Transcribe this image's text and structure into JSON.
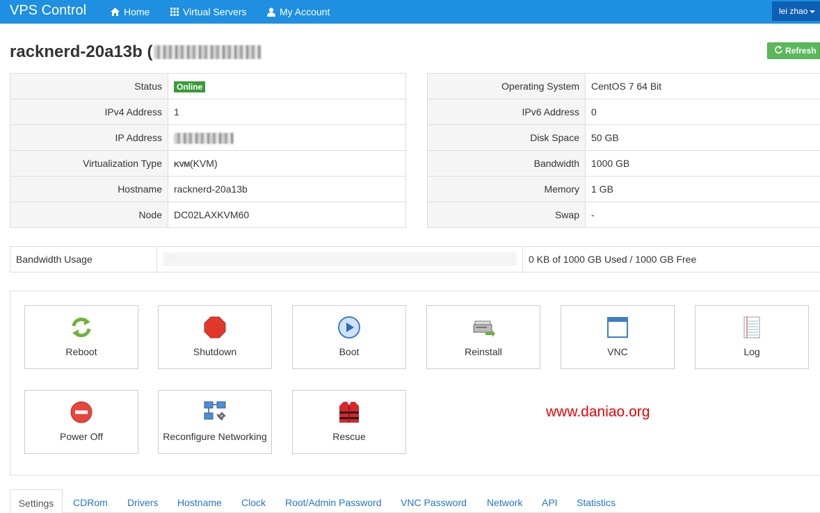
{
  "nav": {
    "brand": "VPS Control",
    "items": [
      {
        "label": "Home",
        "icon": "home-icon"
      },
      {
        "label": "Virtual Servers",
        "icon": "grid-icon"
      },
      {
        "label": "My Account",
        "icon": "user-icon"
      }
    ],
    "user": "lei zhao"
  },
  "page": {
    "title": "racknerd-20a13b (",
    "refresh_label": "Refresh"
  },
  "left_table": [
    {
      "label": "Status",
      "value": "Online"
    },
    {
      "label": "IPv4 Address",
      "value": "1"
    },
    {
      "label": "IP Address",
      "value": ""
    },
    {
      "label": "Virtualization Type",
      "value": "(KVM)",
      "logo": "KVM"
    },
    {
      "label": "Hostname",
      "value": "racknerd-20a13b"
    },
    {
      "label": "Node",
      "value": "DC02LAXKVM60"
    }
  ],
  "right_table": [
    {
      "label": "Operating System",
      "value": "CentOS 7 64 Bit"
    },
    {
      "label": "IPv6 Address",
      "value": "0"
    },
    {
      "label": "Disk Space",
      "value": "50 GB"
    },
    {
      "label": "Bandwidth",
      "value": "1000 GB"
    },
    {
      "label": "Memory",
      "value": "1 GB"
    },
    {
      "label": "Swap",
      "value": "-"
    }
  ],
  "bandwidth": {
    "label": "Bandwidth Usage",
    "percent": 0,
    "percent_text": "0%",
    "summary": "0 KB of 1000 GB Used / 1000 GB Free"
  },
  "actions": [
    {
      "label": "Reboot",
      "icon": "reboot-icon"
    },
    {
      "label": "Shutdown",
      "icon": "stop-icon"
    },
    {
      "label": "Boot",
      "icon": "play-icon"
    },
    {
      "label": "Reinstall",
      "icon": "printer-icon"
    },
    {
      "label": "VNC",
      "icon": "window-icon"
    },
    {
      "label": "Log",
      "icon": "notepad-icon"
    },
    {
      "label": "Power Off",
      "icon": "power-off-icon"
    },
    {
      "label": "Reconfigure Networking",
      "icon": "network-icon"
    },
    {
      "label": "Rescue",
      "icon": "life-vest-icon"
    }
  ],
  "watermark": "www.daniao.org",
  "tabs": [
    "Settings",
    "CDRom",
    "Drivers",
    "Hostname",
    "Clock",
    "Root/Admin Password",
    "VNC Password",
    "Network",
    "API",
    "Statistics"
  ],
  "colors": {
    "navbar": "#1e8fe1",
    "online": "#3a9a3a",
    "refresh": "#5cb85c",
    "link": "#1e77d2",
    "watermark": "#ee0000"
  }
}
